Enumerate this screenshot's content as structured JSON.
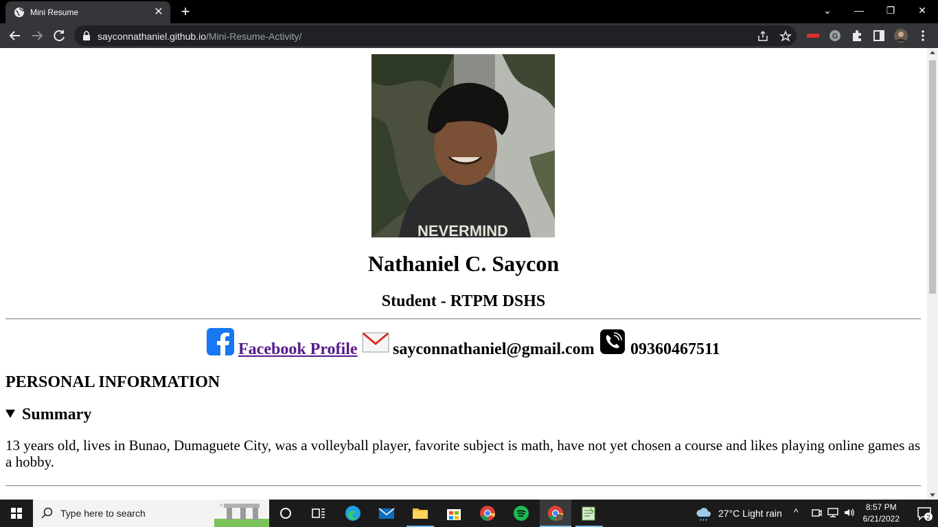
{
  "browser": {
    "tab_title": "Mini Resume",
    "url_host": "sayconnathaniel.github.io",
    "url_path": "/Mini-Resume-Activity/"
  },
  "page": {
    "name": "Nathaniel C. Saycon",
    "role": "Student - RTPM DSHS",
    "facebook_label": "Facebook Profile",
    "email": "sayconnathaniel@gmail.com",
    "phone": "09360467511",
    "section_heading": "PERSONAL INFORMATION",
    "summary_label": "Summary",
    "summary_text": "13 years old, lives in Bunao, Dumaguete City, was a volleyball player, favorite subject is math, have not yet chosen a course and likes playing online games as a hobby.",
    "link_color": "#551a8b"
  },
  "taskbar": {
    "search_placeholder": "Type here to search",
    "weather": "27°C  Light rain",
    "time": "8:57 PM",
    "date": "6/21/2022",
    "notification_count": "2"
  },
  "colors": {
    "chrome_dark": "#35363a",
    "omnibox": "#202124",
    "taskbar": "#1b1b1b",
    "facebook_blue": "#1877f2"
  }
}
